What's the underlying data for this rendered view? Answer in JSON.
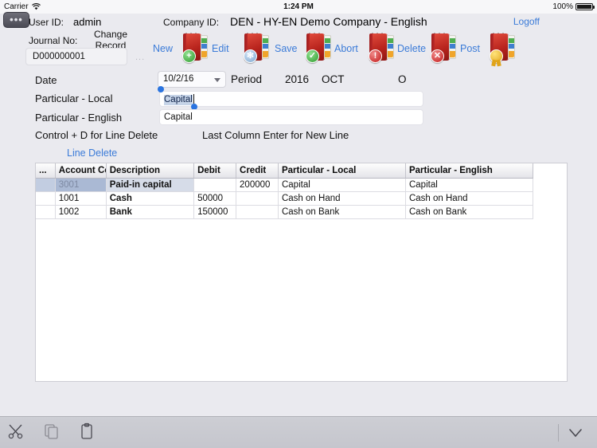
{
  "statusbar": {
    "carrier": "Carrier",
    "wifi_icon": "wifi-icon",
    "time": "1:24 PM",
    "battery_percent": "100%",
    "battery_icon": "battery-full-icon"
  },
  "header": {
    "menu_button_label": "•••",
    "user_id_label": "User ID:",
    "user_id_value": "admin",
    "company_id_label": "Company ID:",
    "company_id_value": "DEN - HY-EN Demo Company - English",
    "logoff_label": "Logoff",
    "journal_no_label": "Journal No:",
    "journal_no_value": "D000000001",
    "journal_more_label": "...",
    "change_record_label": "Change Record"
  },
  "toolbar": {
    "items": [
      {
        "label": "New",
        "icon": "book-new-icon",
        "badge": "+"
      },
      {
        "label": "Edit",
        "icon": "book-edit-icon",
        "badge": ""
      },
      {
        "label": "Save",
        "icon": "book-save-icon",
        "badge": "✓"
      },
      {
        "label": "Abort",
        "icon": "book-abort-icon",
        "badge": "!"
      },
      {
        "label": "Delete",
        "icon": "book-delete-icon",
        "badge": "✕"
      },
      {
        "label": "Post",
        "icon": "book-post-icon",
        "badge": ""
      }
    ]
  },
  "form": {
    "date_label": "Date",
    "date_value": "10/2/16",
    "period_label": "Period",
    "period_year": "2016",
    "period_month": "OCT",
    "period_flag": "O",
    "particular_local_label": "Particular - Local",
    "particular_local_value": "Capital",
    "particular_english_label": "Particular - English",
    "particular_english_value": "Capital",
    "hint_line_delete": "Control + D for Line Delete",
    "hint_new_line": "Last Column Enter for New Line",
    "line_delete_label": "Line Delete"
  },
  "grid": {
    "headers": {
      "select": "...",
      "account_code": "Account Co",
      "description": "Description",
      "debit": "Debit",
      "credit": "Credit",
      "particular_local": "Particular - Local",
      "particular_english": "Particular - English"
    },
    "rows": [
      {
        "select": "",
        "account_code": "3001",
        "description": "Paid-in capital",
        "debit": "",
        "credit": "200000",
        "particular_local": "Capital",
        "particular_english": "Capital",
        "selected": true
      },
      {
        "select": "",
        "account_code": "1001",
        "description": "Cash",
        "debit": "50000",
        "credit": "",
        "particular_local": "Cash on Hand",
        "particular_english": "Cash on Hand",
        "selected": false
      },
      {
        "select": "",
        "account_code": "1002",
        "description": "Bank",
        "debit": "150000",
        "credit": "",
        "particular_local": "Cash on Bank",
        "particular_english": "Cash on Bank",
        "selected": false
      }
    ]
  },
  "keyboard_bar": {
    "cut_icon": "scissors-icon",
    "copy_icon": "copy-icon",
    "paste_icon": "paste-icon",
    "dismiss_icon": "chevron-down-icon"
  },
  "colors": {
    "background": "#eaeaef",
    "link": "#3b7bd8",
    "selection": "#c6d4e8",
    "row_selected": "#aab9d4",
    "icon_red": "#b8241d"
  }
}
